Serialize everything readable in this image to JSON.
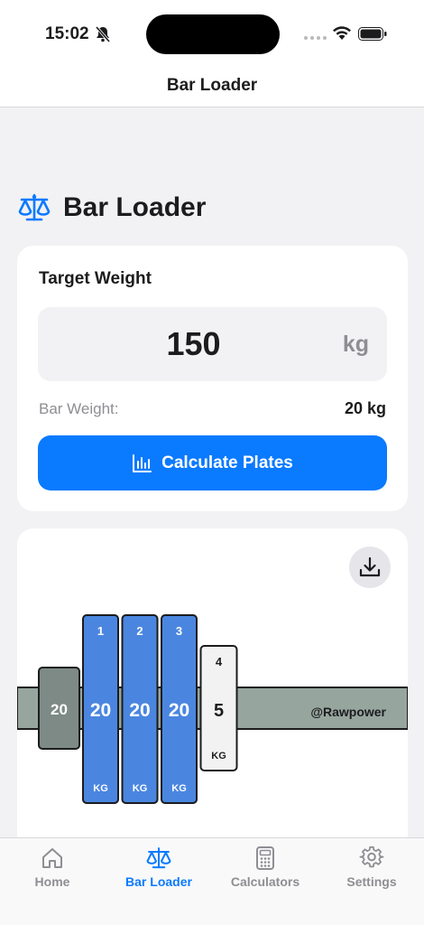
{
  "status_bar": {
    "time": "15:02"
  },
  "nav": {
    "title": "Bar Loader"
  },
  "page": {
    "title": "Bar Loader",
    "icon": "scale-icon"
  },
  "target": {
    "label": "Target Weight",
    "value": "150",
    "unit": "kg",
    "bar_weight_label": "Bar Weight:",
    "bar_weight_value": "20 kg",
    "calculate_label": "Calculate Plates"
  },
  "loader": {
    "watermark": "@Rawpower",
    "collar_label": "20",
    "plates": [
      {
        "index": "1",
        "weight": "20",
        "unit": "KG",
        "color": "#4a86e0"
      },
      {
        "index": "2",
        "weight": "20",
        "unit": "KG",
        "color": "#4a86e0"
      },
      {
        "index": "3",
        "weight": "20",
        "unit": "KG",
        "color": "#4a86e0"
      },
      {
        "index": "4",
        "weight": "5",
        "unit": "KG",
        "color": "#f2f2f2"
      }
    ]
  },
  "tabs": [
    {
      "label": "Home",
      "icon": "home-icon",
      "active": false
    },
    {
      "label": "Bar Loader",
      "icon": "scale-icon",
      "active": true
    },
    {
      "label": "Calculators",
      "icon": "calculator-icon",
      "active": false
    },
    {
      "label": "Settings",
      "icon": "gear-icon",
      "active": false
    }
  ],
  "colors": {
    "accent": "#0a7aff",
    "plate_blue": "#4a86e0",
    "bar": "#97a59f",
    "collar": "#7d8a86"
  }
}
